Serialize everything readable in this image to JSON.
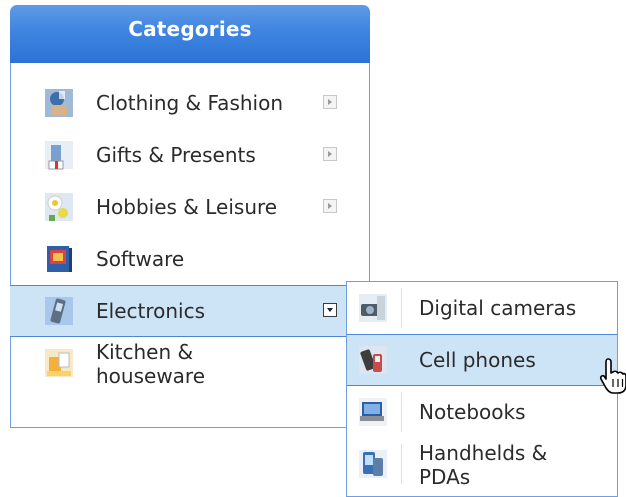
{
  "panel": {
    "title": "Categories"
  },
  "categories": [
    {
      "label": "Clothing & Fashion",
      "icon": "clothing-icon",
      "has_submenu": true
    },
    {
      "label": "Gifts & Presents",
      "icon": "gift-icon",
      "has_submenu": true
    },
    {
      "label": "Hobbies & Leisure",
      "icon": "hobbies-icon",
      "has_submenu": true
    },
    {
      "label": "Software",
      "icon": "software-box-icon",
      "has_submenu": false
    },
    {
      "label": "Electronics",
      "icon": "electronics-icon",
      "has_submenu": true,
      "expanded": true
    },
    {
      "label_line1": "Kitchen &",
      "label_line2": "houseware",
      "icon": "kitchen-icon",
      "has_submenu": false
    }
  ],
  "submenu": {
    "parent": "Electronics",
    "items": [
      {
        "label": "Digital cameras",
        "icon": "camera-icon"
      },
      {
        "label": "Cell phones",
        "icon": "cell-phone-icon",
        "hovered": true
      },
      {
        "label": "Notebooks",
        "icon": "notebook-icon"
      },
      {
        "label_line1": "Handhelds &",
        "label_line2": "PDAs",
        "icon": "pda-icon"
      }
    ]
  },
  "colors": {
    "header": "#3f84e0",
    "highlight": "#cde4f7",
    "border": "#6f9fe2"
  }
}
